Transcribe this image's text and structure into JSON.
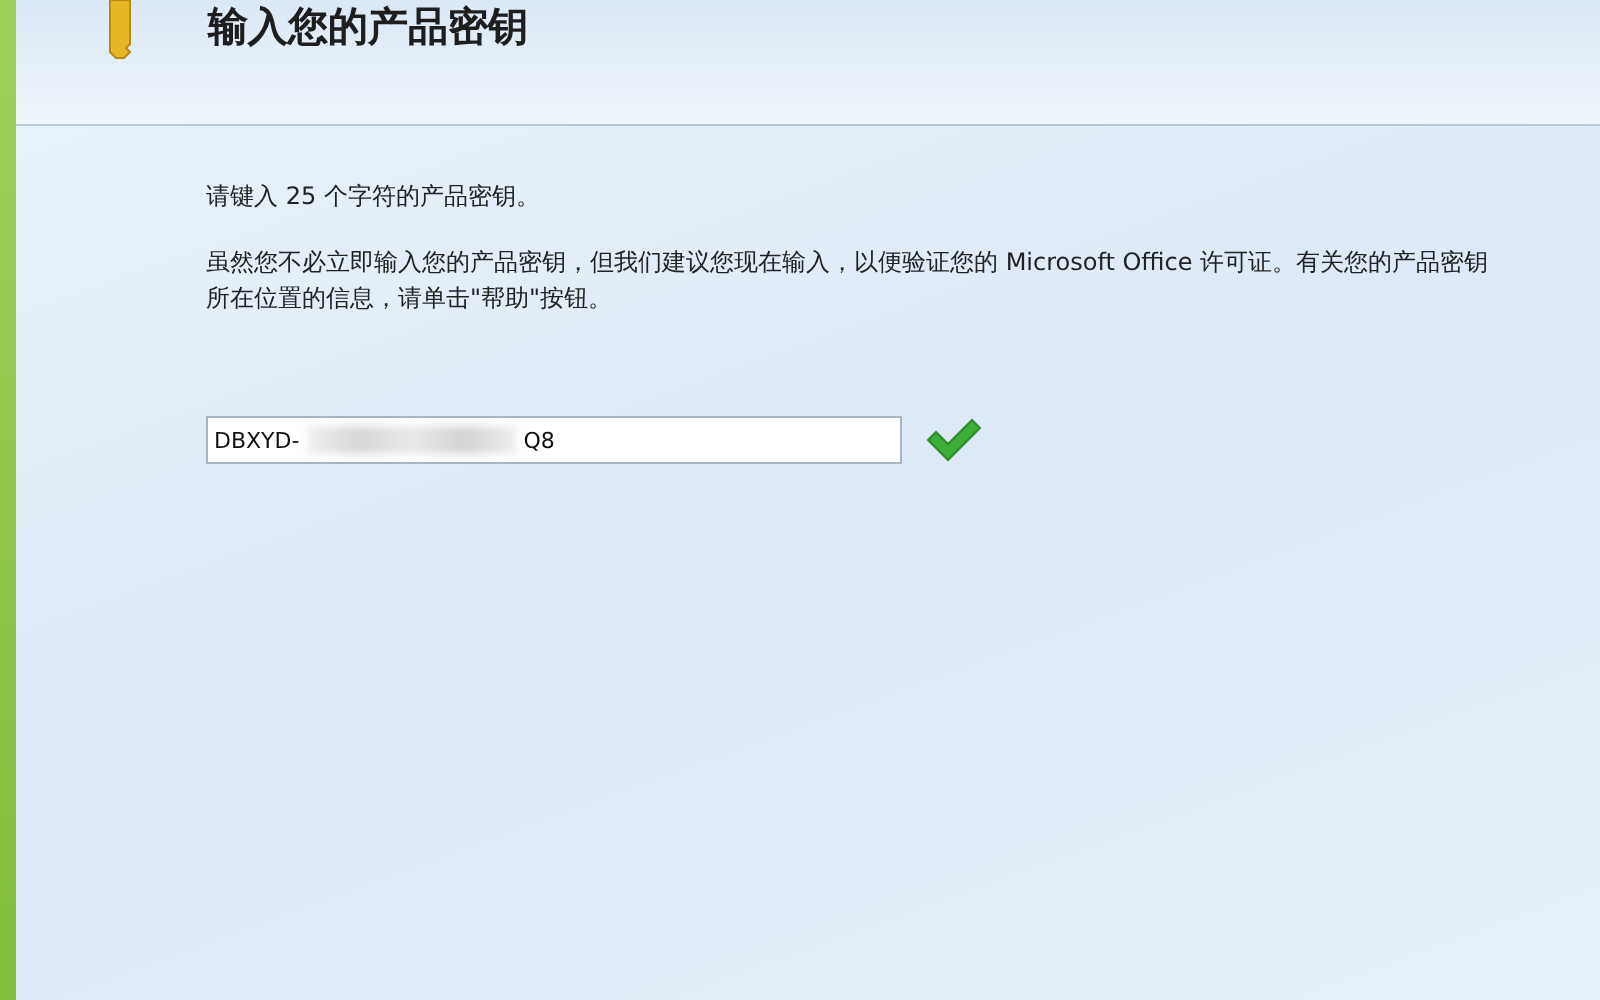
{
  "header": {
    "title": "输入您的产品密钥"
  },
  "body": {
    "instruction": "请键入 25 个字符的产品密钥。",
    "explanation": "虽然您不必立即输入您的产品密钥，但我们建议您现在输入，以便验证您的 Microsoft Office 许可证。有关您的产品密钥所在位置的信息，请单击\"帮助\"按钮。"
  },
  "key_field": {
    "value_start": "DBXYD-",
    "value_end": "Q8",
    "valid": true
  }
}
